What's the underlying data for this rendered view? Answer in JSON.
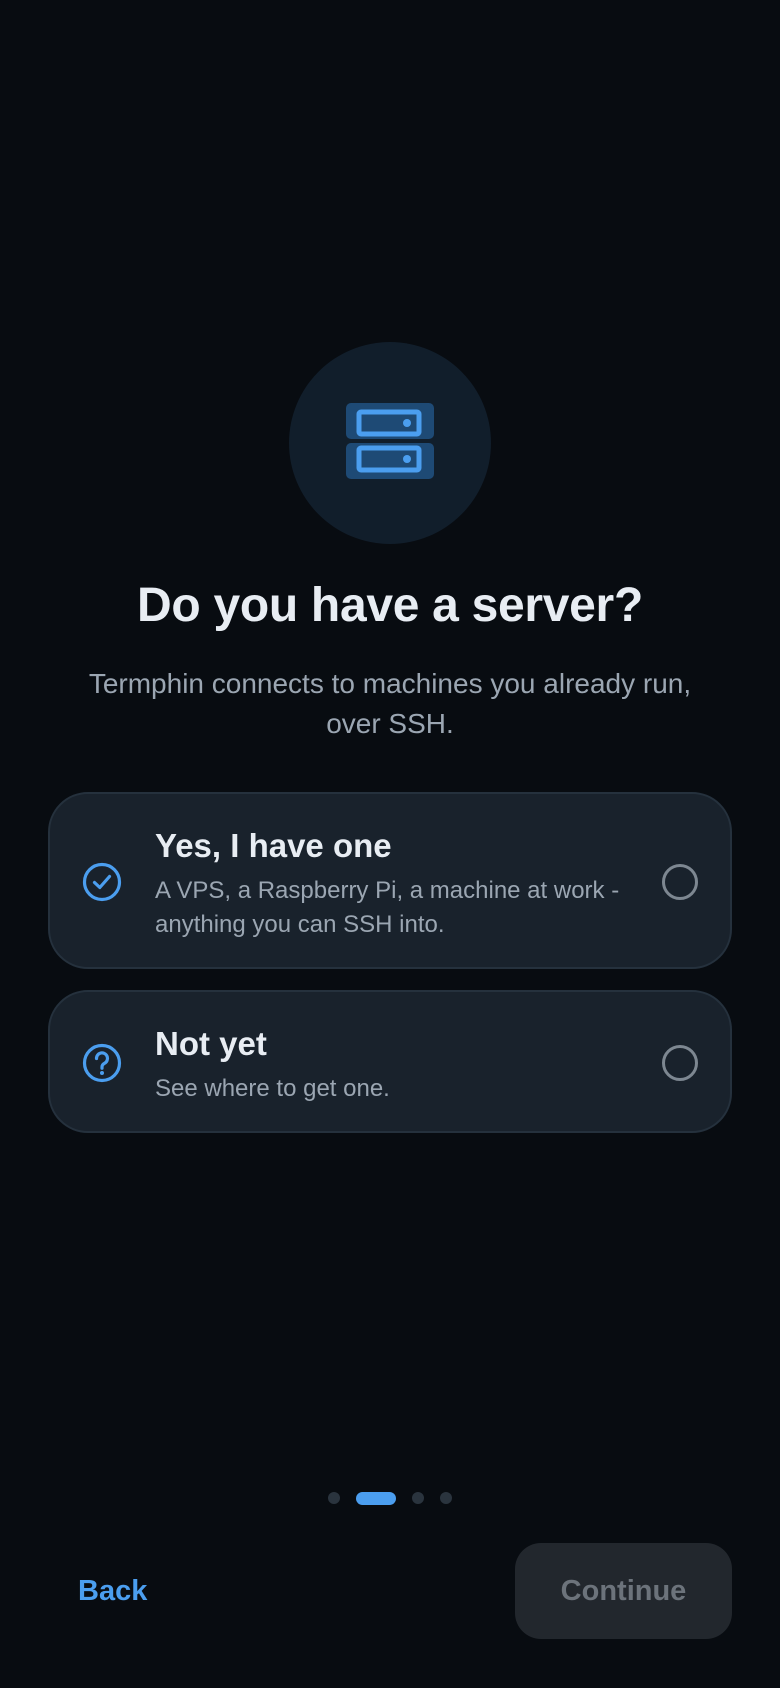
{
  "hero": {
    "icon": "server-icon"
  },
  "heading": {
    "title": "Do you have a server?",
    "subtitle": "Termphin connects to machines you already run, over SSH."
  },
  "options": [
    {
      "icon": "check-circle-icon",
      "title": "Yes, I have one",
      "description": "A VPS, a Raspberry Pi, a machine at work - anything you can SSH into.",
      "selected": false
    },
    {
      "icon": "help-circle-icon",
      "title": "Not yet",
      "description": "See where to get one.",
      "selected": false
    }
  ],
  "pager": {
    "total_steps": 4,
    "current_step": 2
  },
  "footer": {
    "back_label": "Back",
    "continue_label": "Continue",
    "continue_enabled": false
  },
  "colors": {
    "background": "#080c11",
    "card": "#19222c",
    "accent": "#4b9eef",
    "text_primary": "#e8edf3",
    "text_secondary": "#9ba6b2",
    "disabled_button": "#22272d",
    "disabled_text": "#6c737b"
  }
}
